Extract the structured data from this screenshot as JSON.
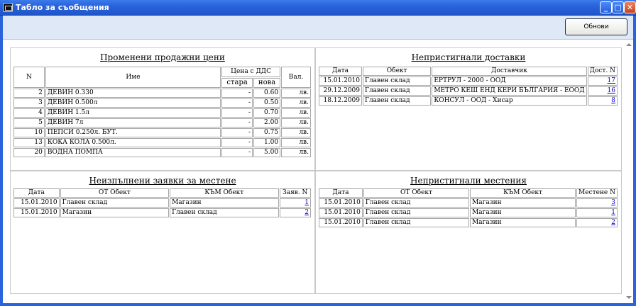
{
  "window": {
    "title": "Табло за съобщения",
    "refresh_label": "Обнови"
  },
  "prices": {
    "title": "Променени продажни цени",
    "headers": {
      "n": "N",
      "name": "Име",
      "price_group": "Цена с ДДС",
      "old": "стара",
      "new": "нова",
      "cur": "Вал."
    },
    "rows": [
      {
        "n": "2",
        "name": "ДЕВИН 0.330",
        "old": "-",
        "new": "0.60",
        "cur": "лв."
      },
      {
        "n": "3",
        "name": "ДЕВИН 0.500л",
        "old": "-",
        "new": "0.50",
        "cur": "лв."
      },
      {
        "n": "4",
        "name": "ДЕВИН 1.5л",
        "old": "-",
        "new": "0.70",
        "cur": "лв."
      },
      {
        "n": "5",
        "name": "ДЕВИН 7л",
        "old": "-",
        "new": "2.00",
        "cur": "лв."
      },
      {
        "n": "10",
        "name": "ПЕПСИ 0.250л. БУТ.",
        "old": "-",
        "new": "0.75",
        "cur": "лв."
      },
      {
        "n": "13",
        "name": "КОКА КОЛА 0.500л.",
        "old": "-",
        "new": "1.00",
        "cur": "лв."
      },
      {
        "n": "20",
        "name": "ВОДНА ПОМПА",
        "old": "-",
        "new": "5.00",
        "cur": "лв."
      }
    ]
  },
  "deliveries": {
    "title": "Непристигнали доставки",
    "headers": {
      "date": "Дата",
      "object": "Обект",
      "supplier": "Доставчик",
      "num": "Дост. N"
    },
    "rows": [
      {
        "date": "15.01.2010",
        "object": "Главен склад",
        "supplier": "ЕРТРУЛ - 2000 - ООД",
        "num": "17"
      },
      {
        "date": "29.12.2009",
        "object": "Главен склад",
        "supplier": "МЕТРО КЕШ ЕНД КЕРИ БЪЛГАРИЯ - ЕООД",
        "num": "16"
      },
      {
        "date": "18.12.2009",
        "object": "Главен склад",
        "supplier": "КОНСУЛ - ООД - Хисар",
        "num": "8"
      }
    ]
  },
  "requests": {
    "title": "Неизпълнени заявки за местене",
    "headers": {
      "date": "Дата",
      "from": "ОТ Обект",
      "to": "КЪМ Обект",
      "num": "Заяв. N"
    },
    "rows": [
      {
        "date": "15.01.2010",
        "from": "Главен склад",
        "to": "Магазин",
        "num": "1"
      },
      {
        "date": "15.01.2010",
        "from": "Магазин",
        "to": "Главен склад",
        "num": "2"
      }
    ]
  },
  "transfers": {
    "title": "Непристигнали местения",
    "headers": {
      "date": "Дата",
      "from": "ОТ Обект",
      "to": "КЪМ Обект",
      "num": "Местене N"
    },
    "rows": [
      {
        "date": "15.01.2010",
        "from": "Главен склад",
        "to": "Магазин",
        "num": "3"
      },
      {
        "date": "15.01.2010",
        "from": "Главен склад",
        "to": "Магазин",
        "num": "1"
      },
      {
        "date": "15.01.2010",
        "from": "Главен склад",
        "to": "Магазин",
        "num": "2"
      }
    ]
  }
}
